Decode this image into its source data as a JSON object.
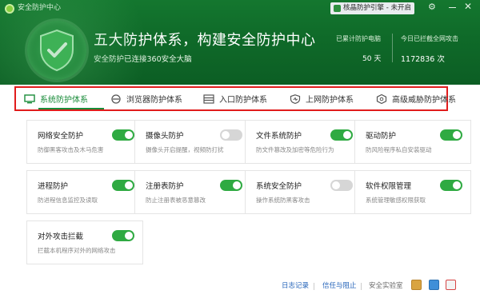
{
  "app": {
    "title": "安全防护中心"
  },
  "engine": {
    "label": "核晶防护引擎 - 未开启"
  },
  "header": {
    "headline": "五大防护体系，构建安全防护中心",
    "subline": "安全防护已连接360安全大脑",
    "stats": [
      {
        "label": "已累计防护电脑",
        "value": "50 天"
      },
      {
        "label": "今日已拦截全网攻击",
        "value": "1172836 次"
      }
    ]
  },
  "tabs": [
    {
      "label": "系统防护体系",
      "icon": "monitor-icon",
      "active": true
    },
    {
      "label": "浏览器防护体系",
      "icon": "browser-icon",
      "active": false
    },
    {
      "label": "入口防护体系",
      "icon": "entrance-icon",
      "active": false
    },
    {
      "label": "上网防护体系",
      "icon": "shield-heart-icon",
      "active": false
    },
    {
      "label": "高级威胁防护体系",
      "icon": "hexagon-icon",
      "active": false
    }
  ],
  "cards": [
    {
      "name": "网络安全防护",
      "desc": "防御黑客攻击及木马危害",
      "on": true
    },
    {
      "name": "摄像头防护",
      "desc": "摄像头开启提醒，视频防打扰",
      "on": false
    },
    {
      "name": "文件系统防护",
      "desc": "防文件篡改及加密等危险行为",
      "on": true
    },
    {
      "name": "驱动防护",
      "desc": "防风险程序私自安装驱动",
      "on": true
    },
    {
      "name": "进程防护",
      "desc": "防进程信息监控及读取",
      "on": true
    },
    {
      "name": "注册表防护",
      "desc": "防止注册表被恶意篡改",
      "on": true
    },
    {
      "name": "系统安全防护",
      "desc": "操作系统防黑客攻击",
      "on": false
    },
    {
      "name": "软件权限管理",
      "desc": "系统管理敏感权限获取",
      "on": true
    },
    {
      "name": "对外攻击拦截",
      "desc": "拦截本机程序对外的网络攻击",
      "on": true
    }
  ],
  "footer": {
    "log": "日志记录",
    "trust": "信任与阻止",
    "lab": "安全实验室"
  },
  "colors": {
    "brand_green": "#1a8c3a",
    "header_green": "#0f6a29",
    "highlight_red": "#e11c1c"
  }
}
